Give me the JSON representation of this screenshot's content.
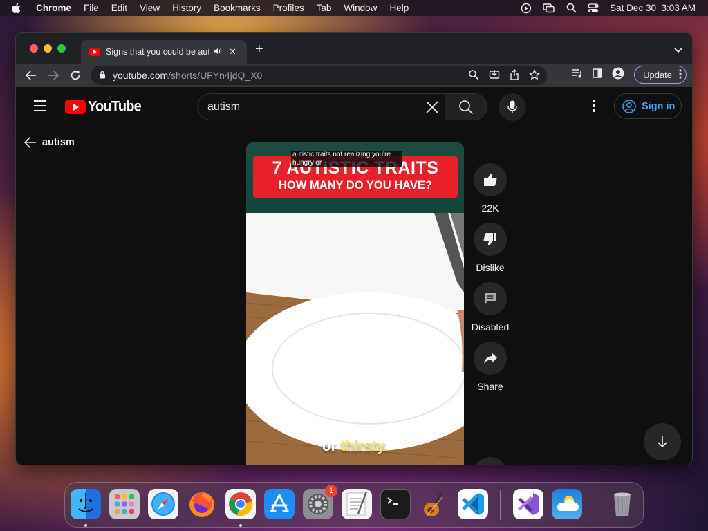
{
  "menubar": {
    "app": "Chrome",
    "items": [
      "File",
      "Edit",
      "View",
      "History",
      "Bookmarks",
      "Profiles",
      "Tab",
      "Window",
      "Help"
    ],
    "clock": "Sat Dec 30  3:03 AM"
  },
  "browser": {
    "tab_title": "Signs that you could be autistic",
    "url_host": "youtube.com",
    "url_path": "/shorts/UFYn4jdQ_X0",
    "update_label": "Update"
  },
  "youtube": {
    "logo_text": "YouTube",
    "search_value": "autism",
    "signin_label": "Sign in",
    "back_label": "autism"
  },
  "video": {
    "banner_line1": "7 AUTISTIC TRAITS",
    "banner_line2": "HOW MANY DO YOU HAVE?",
    "caption": "autistic traits not realizing you're hungry or",
    "subtitle_pre": "or ",
    "subtitle_highlight": "thirsty."
  },
  "actions": {
    "like_count": "22K",
    "dislike_label": "Dislike",
    "comments_label": "Disabled",
    "share_label": "Share"
  },
  "dock": {
    "apps": [
      "finder",
      "launchpad",
      "safari",
      "firefox",
      "chrome",
      "app-store",
      "system-settings",
      "textedit",
      "terminal",
      "garageband",
      "vscode",
      "visual-studio",
      "weather",
      "trash"
    ],
    "settings_badge": "1"
  },
  "colors": {
    "youtube_red": "#ff0000",
    "signin_blue": "#3ea6ff",
    "banner_red": "#e8202a"
  }
}
